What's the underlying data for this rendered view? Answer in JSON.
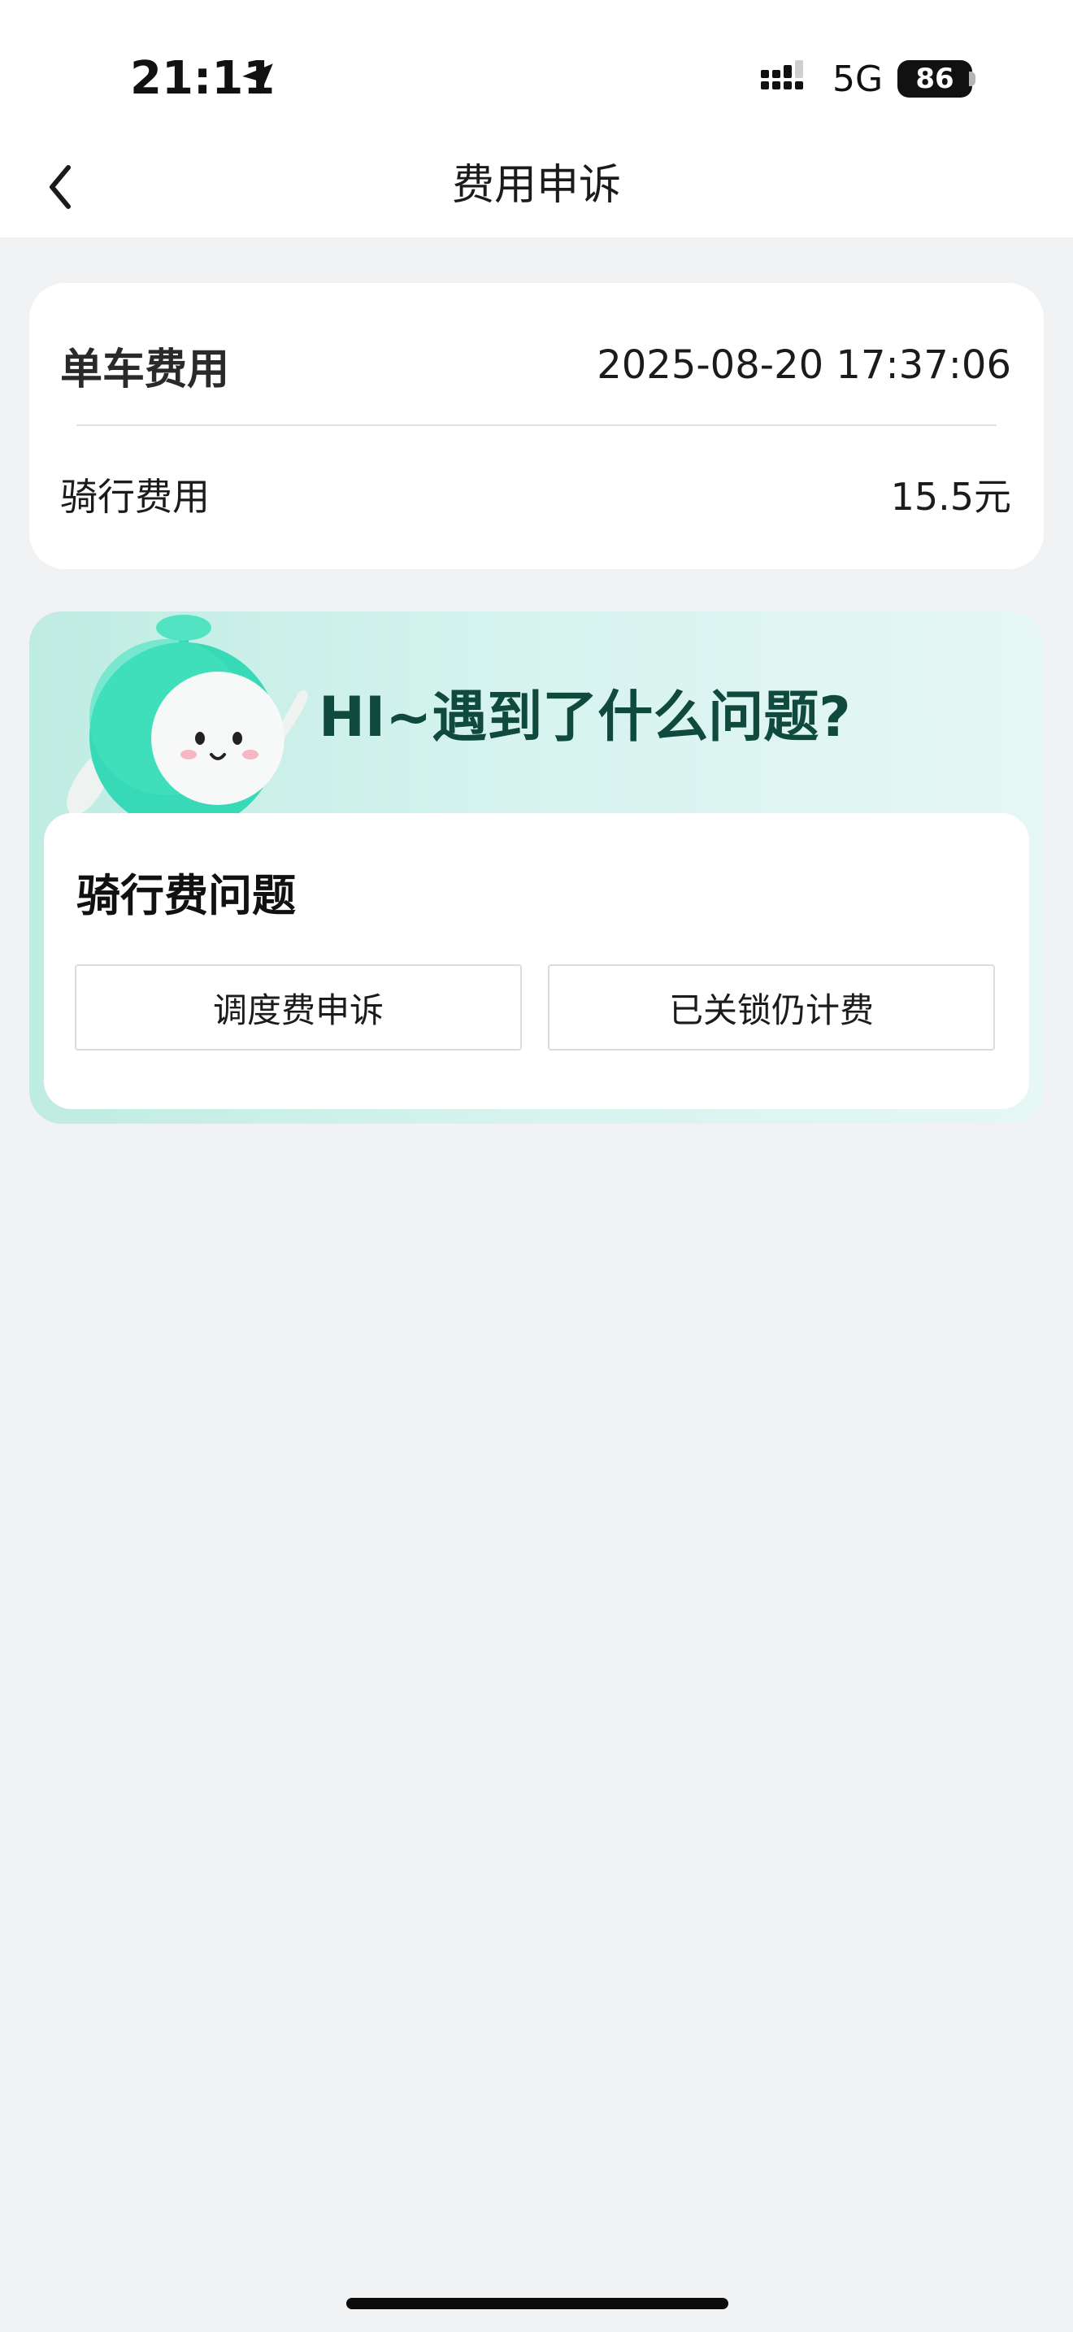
{
  "status_bar": {
    "time": "21:11",
    "network": "5G",
    "battery": "86",
    "icons": [
      "location-arrow-icon",
      "signal-icon",
      "battery-icon"
    ]
  },
  "nav": {
    "title": "费用申诉",
    "back_icon": "chevron-left-icon"
  },
  "fee_card": {
    "title": "单车费用",
    "datetime": "2025-08-20 17:37:06",
    "riding_label": "骑行费用",
    "riding_value": "15.5元"
  },
  "question_card": {
    "heading": "HI~遇到了什么问题?",
    "category_title": "骑行费问题",
    "options": [
      {
        "label": "调度费申诉"
      },
      {
        "label": "已关锁仍计费"
      }
    ],
    "mascot": "mascot-robot-icon"
  },
  "colors": {
    "page_bg": "#f1f2f4",
    "card_bg": "#ffffff",
    "accent_green": "#3fdcb8",
    "heading_green": "#0f4a3c"
  }
}
